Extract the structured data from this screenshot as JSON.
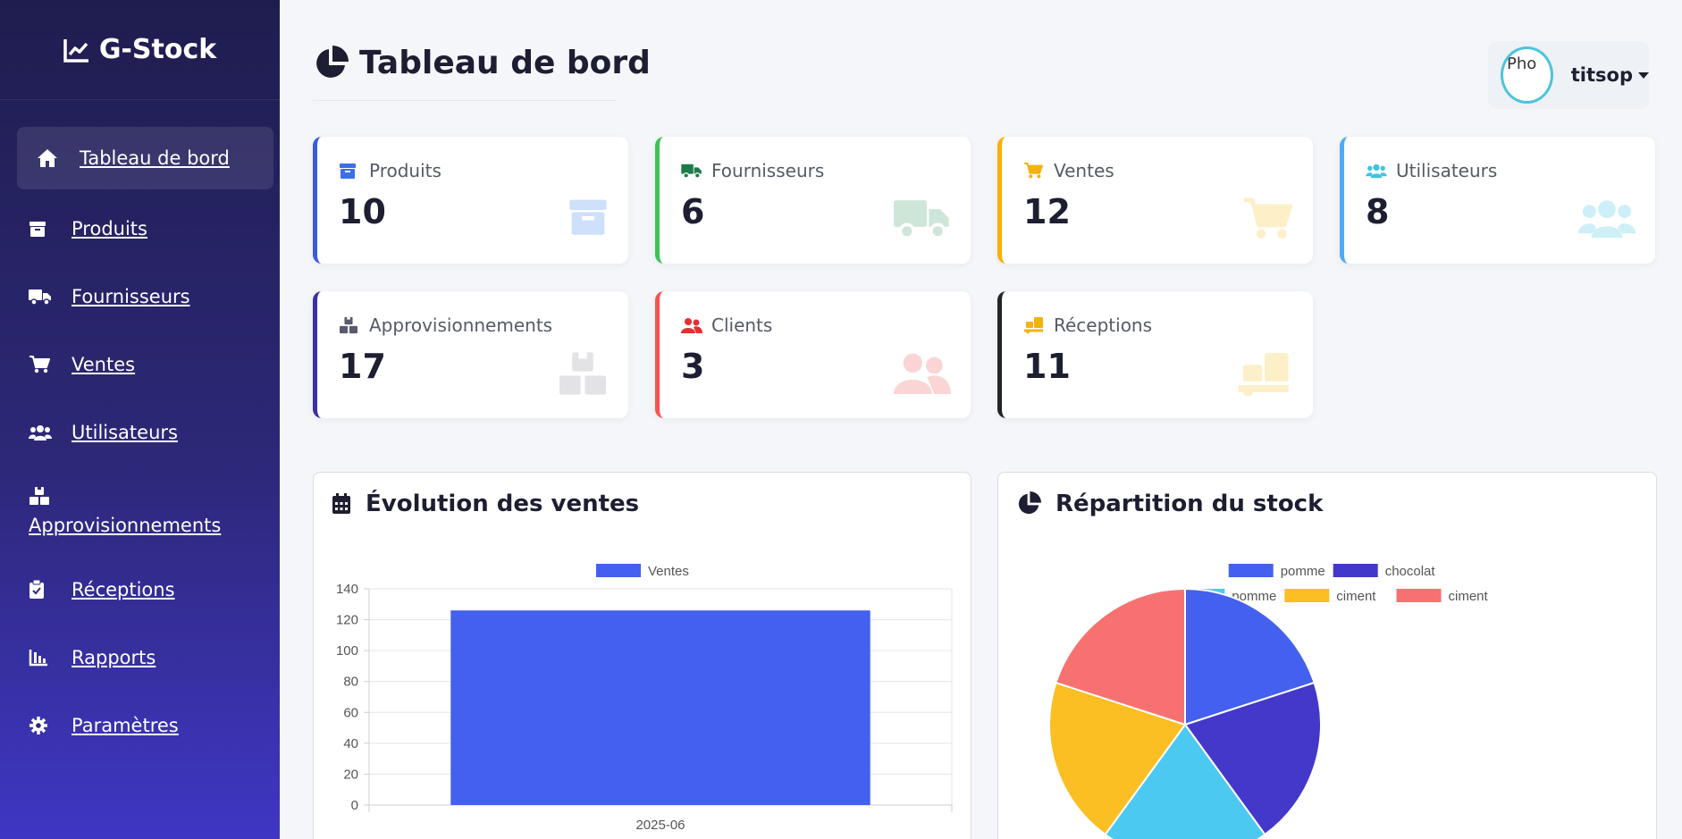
{
  "brand": {
    "name": "G-Stock"
  },
  "sidebar": {
    "items": [
      {
        "label": "Tableau de bord",
        "icon": "home-icon"
      },
      {
        "label": "Produits",
        "icon": "box-icon"
      },
      {
        "label": "Fournisseurs",
        "icon": "truck-icon"
      },
      {
        "label": "Ventes",
        "icon": "cart-icon"
      },
      {
        "label": "Utilisateurs",
        "icon": "users-icon"
      },
      {
        "label": "Approvisionnements",
        "icon": "boxes-icon"
      },
      {
        "label": "Réceptions",
        "icon": "clipboard-check-icon"
      },
      {
        "label": "Rapports",
        "icon": "bar-chart-icon"
      },
      {
        "label": "Paramètres",
        "icon": "gear-icon"
      }
    ]
  },
  "header": {
    "title": "Tableau de bord",
    "user": {
      "avatar_alt": "Pho",
      "name": "titsop"
    }
  },
  "stats": [
    {
      "label": "Produits",
      "value": "10",
      "icon": "box-icon",
      "color": "#3b5bdb"
    },
    {
      "label": "Fournisseurs",
      "value": "6",
      "icon": "truck-icon",
      "color": "#40c057"
    },
    {
      "label": "Ventes",
      "value": "12",
      "icon": "cart-icon",
      "color": "#fab005"
    },
    {
      "label": "Utilisateurs",
      "value": "8",
      "icon": "users-icon",
      "color": "#4dabf7"
    },
    {
      "label": "Approvisionnements",
      "value": "17",
      "icon": "boxes-icon",
      "color": "#3a2fa3"
    },
    {
      "label": "Clients",
      "value": "3",
      "icon": "users-icon",
      "color": "#fa5252"
    },
    {
      "label": "Réceptions",
      "value": "11",
      "icon": "dolly-icon",
      "color": "#212529"
    }
  ],
  "panels": {
    "sales": {
      "title": "Évolution des ventes"
    },
    "stock": {
      "title": "Répartition du stock"
    }
  },
  "chart_data": [
    {
      "type": "bar",
      "title": "Évolution des ventes",
      "categories": [
        "2025-06"
      ],
      "series": [
        {
          "name": "Ventes",
          "values": [
            126
          ],
          "color": "#4361ee"
        }
      ],
      "ylim": [
        0,
        140
      ],
      "yticks": [
        0,
        20,
        40,
        60,
        80,
        100,
        120,
        140
      ],
      "grid": true,
      "legend": "top"
    },
    {
      "type": "pie",
      "title": "Répartition du stock",
      "labels": [
        "pomme",
        "chocolat",
        "pomme",
        "ciment",
        "ciment"
      ],
      "values": [
        20,
        20,
        20,
        20,
        20
      ],
      "colors": [
        "#4361ee",
        "#4338ca",
        "#4cc9f0",
        "#fbbf24",
        "#f87171"
      ],
      "legend": "top"
    }
  ]
}
